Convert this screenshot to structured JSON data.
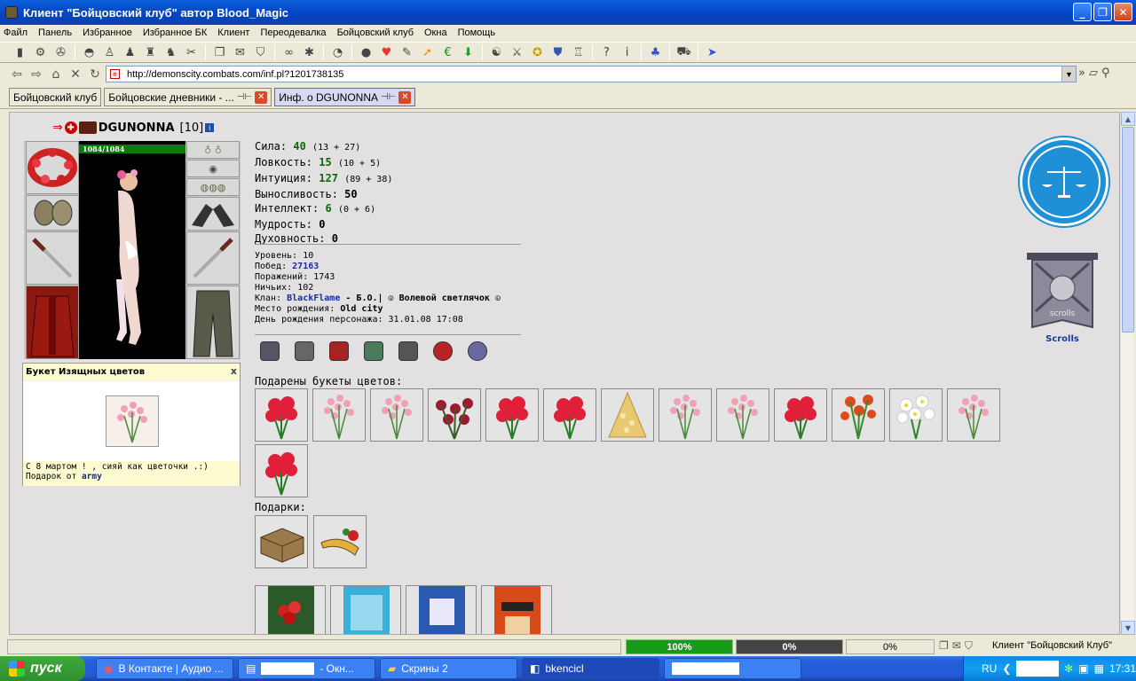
{
  "window": {
    "title": "Клиент \"Бойцовский клуб\" автор Blood_Magic",
    "min": "_",
    "max": "❐",
    "close": "✕"
  },
  "menu": [
    "Файл",
    "Панель",
    "Избранное",
    "Избранное БК",
    "Клиент",
    "Переодевалка",
    "Бойцовский клуб",
    "Окна",
    "Помощь"
  ],
  "address": {
    "url": "http://demonscity.combats.com/inf.pl?1201738135"
  },
  "tabs": [
    {
      "label": "Бойцовский клуб"
    },
    {
      "label": "Бойцовские дневники - ..."
    },
    {
      "label": "Инф. о DGUNONNA"
    }
  ],
  "character": {
    "name": "DGUNONNA",
    "level": "[10]",
    "hp": "1084/1084"
  },
  "stats": [
    {
      "label": "Сила:",
      "value": "40",
      "extra": "(13 + 27)"
    },
    {
      "label": "Ловкость:",
      "value": "15",
      "extra": "(10 + 5)"
    },
    {
      "label": "Интуиция:",
      "value": "127",
      "extra": "(89 + 38)"
    },
    {
      "label": "Выносливость:",
      "value": "50",
      "extra": ""
    },
    {
      "label": "Интеллект:",
      "value": "6",
      "extra": "(0 + 6)"
    },
    {
      "label": "Мудрость:",
      "value": "0",
      "extra": ""
    },
    {
      "label": "Духовность:",
      "value": "0",
      "extra": ""
    }
  ],
  "info": {
    "level_label": "Уровень:",
    "level": "10",
    "wins_label": "Побед:",
    "wins": "27163",
    "losses_label": "Поражений:",
    "losses": "1743",
    "draws_label": "Ничьих:",
    "draws": "102",
    "clan_label": "Клан:",
    "clan": "BlackFlame",
    "clan_rank": "- Б.О.| ☮ Волевой светлячок ☮",
    "birthplace_label": "Место рождения:",
    "birthplace": "Old city",
    "birthday_label": "День рождения персонажа:",
    "birthday": "31.01.08 17:08"
  },
  "popup": {
    "title": "Букет Изящных цветов",
    "close": "x",
    "message": "С 8 мартом ! , сияй как цветочки .:)",
    "from_label": "Подарок от",
    "from": "army"
  },
  "sections": {
    "flowers": "Подарены букеты цветов:",
    "gifts": "Подарки:"
  },
  "scrolls_label": "Scrolls",
  "scrolls_text": "scrolls",
  "status": {
    "progress1": "100%",
    "progress2": "0%",
    "progress3": "0%",
    "app": "Клиент \"Бойцовский Клуб\""
  },
  "taskbar": {
    "start": "пуск",
    "tasks": [
      "В Контакте | Аудио ...",
      "- Окн...",
      "Скрины 2",
      "bkencicl"
    ],
    "lang": "RU",
    "clock": "17:31"
  },
  "colors": {
    "xp_blue": "#0a5fd8",
    "stat_green": "#0a6a0a",
    "link_blue": "#1a2a9a",
    "hp_green": "#0a7a0a"
  }
}
